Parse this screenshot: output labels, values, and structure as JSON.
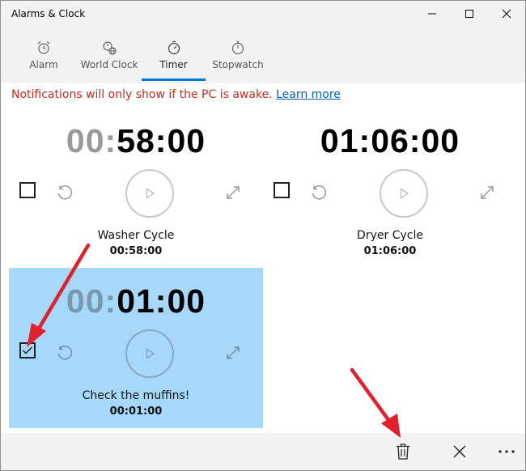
{
  "window": {
    "title": "Alarms & Clock",
    "controls": [
      "minimize-icon",
      "maximize-icon",
      "close-icon"
    ]
  },
  "tabs": [
    {
      "label": "Alarm",
      "icon": "alarm-icon",
      "active": false
    },
    {
      "label": "World Clock",
      "icon": "world-clock-icon",
      "active": false
    },
    {
      "label": "Timer",
      "icon": "timer-icon",
      "active": true
    },
    {
      "label": "Stopwatch",
      "icon": "stopwatch-icon",
      "active": false
    }
  ],
  "notice": {
    "text": "Notifications will only show if the PC is awake.",
    "link": "Learn more"
  },
  "timers": [
    {
      "hours": "00",
      "rest": "58:00",
      "hours_dimmed": true,
      "name": "Washer Cycle",
      "remaining": "00:58:00",
      "selected": false,
      "checked": false
    },
    {
      "hours": "01",
      "rest": "06:00",
      "hours_dimmed": false,
      "name": "Dryer Cycle",
      "remaining": "01:06:00",
      "selected": false,
      "checked": false
    },
    {
      "hours": "00",
      "rest": "01:00",
      "hours_dimmed": true,
      "name": "Check the muffins!",
      "remaining": "00:01:00",
      "selected": true,
      "checked": true
    }
  ],
  "commandbar": {
    "buttons": [
      "delete-icon",
      "cancel-icon",
      "more-icon"
    ]
  },
  "colors": {
    "accent": "#0078d7",
    "selected_card": "#a6d8fb",
    "notice_text": "#c42b1c",
    "link": "#0063b1",
    "annotation_arrow": "#e0202a"
  }
}
